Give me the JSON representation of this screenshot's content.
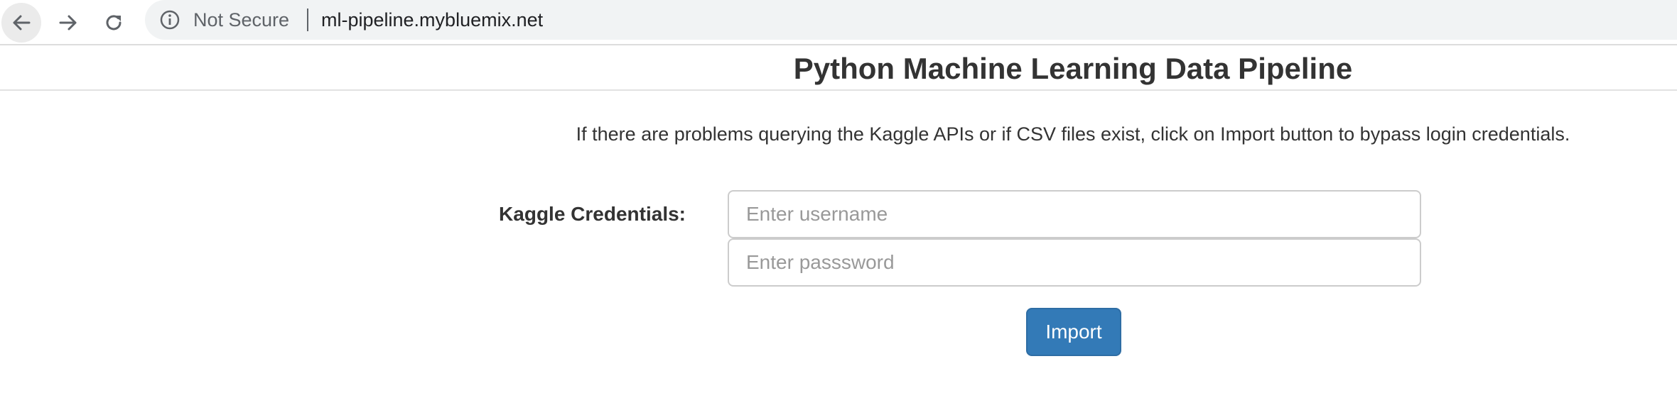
{
  "browser": {
    "security_label": "Not Secure",
    "url": "ml-pipeline.mybluemix.net",
    "icons": {
      "back": "arrow-left-icon",
      "forward": "arrow-right-icon",
      "reload": "reload-icon",
      "info": "info-icon"
    }
  },
  "page": {
    "title": "Python Machine Learning Data Pipeline",
    "help_text": "If there are problems querying the Kaggle APIs or if CSV files exist, click on Import button to bypass login credentials."
  },
  "form": {
    "credentials_label": "Kaggle Credentials:",
    "username_placeholder": "Enter username",
    "username_value": "",
    "password_placeholder": "Enter passsword",
    "password_value": "",
    "import_label": "Import"
  },
  "colors": {
    "primary_button": "#337ab7",
    "text": "#333333",
    "omnibox": "#f1f3f4"
  }
}
